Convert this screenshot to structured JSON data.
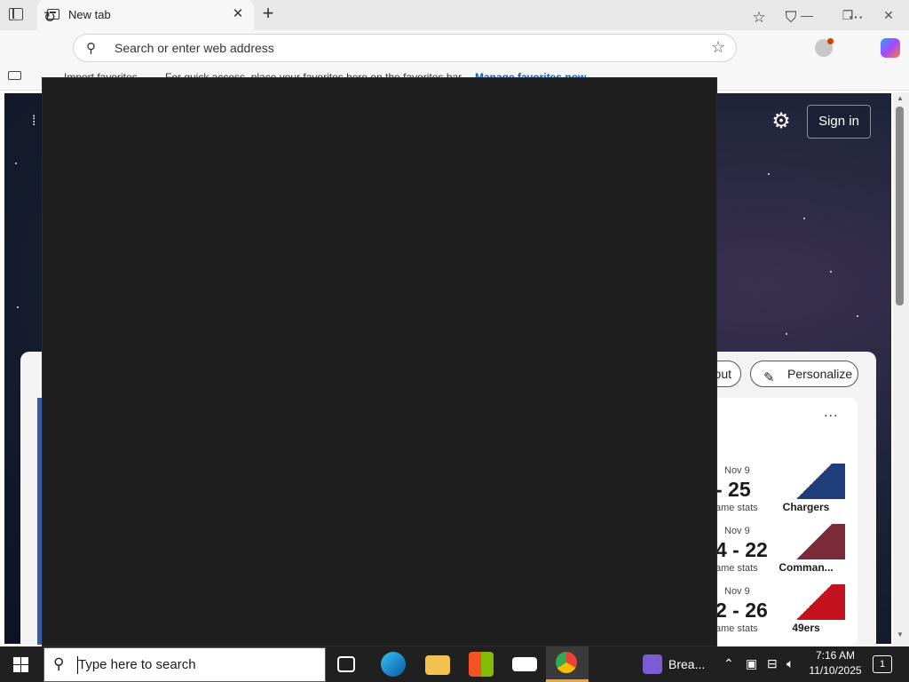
{
  "browser": {
    "tab_title": "New tab",
    "tab_close": "✕",
    "new_tab": "+",
    "window_controls": {
      "minimize": "—",
      "maximize": "❐",
      "close": "✕"
    },
    "address_placeholder": "Search or enter web address",
    "favorites_bar": {
      "import_label": "Import favorites",
      "hint": "For quick access, place your favorites here on the favorites bar.",
      "manage_label": "Manage favorites now"
    }
  },
  "page": {
    "sign_in": "Sign in",
    "about_label": "out",
    "personalize_label": "Personalize",
    "sports": {
      "more": "...",
      "games": [
        {
          "date": "Nov 9",
          "score": "- 25",
          "stats": "ame stats",
          "team": "Chargers",
          "color": "#1f3d7a"
        },
        {
          "date": "Nov 9",
          "score": "4 - 22",
          "stats": "ame stats",
          "team": "Comman...",
          "color": "#7a2a38"
        },
        {
          "date": "Nov 9",
          "score": "2 - 26",
          "stats": "ame stats",
          "team": "49ers",
          "color": "#c3121e"
        }
      ]
    }
  },
  "taskbar": {
    "search_placeholder": "Type here to search",
    "teams_label": "Brea...",
    "clock_time": "7:16 AM",
    "clock_date": "11/10/2025",
    "notif_count": "1"
  }
}
